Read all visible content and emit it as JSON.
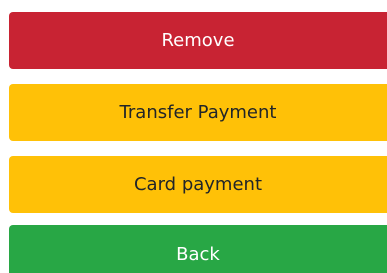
{
  "actions": {
    "remove_label": "Remove",
    "transfer_payment_label": "Transfer Payment",
    "card_payment_label": "Card payment",
    "back_label": "Back"
  },
  "colors": {
    "danger": "#c82333",
    "warning": "#ffc107",
    "success": "#28a745",
    "dark_text": "#212529",
    "light_text": "#ffffff"
  }
}
